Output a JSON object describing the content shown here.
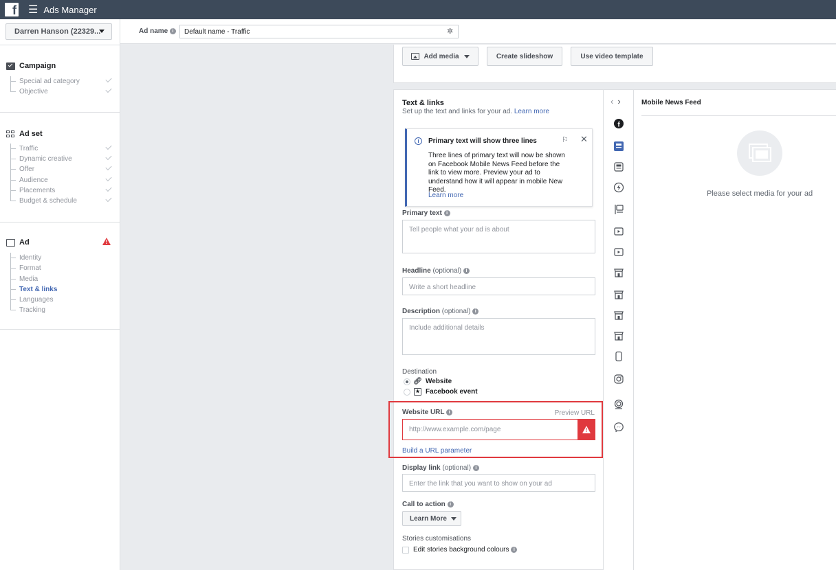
{
  "topbar": {
    "app_title": "Ads Manager"
  },
  "account": {
    "name": "Darren Hanson (22329..."
  },
  "ad_name": {
    "label": "Ad name",
    "value": "Default name - Traffic"
  },
  "nav": {
    "campaign": {
      "title": "Campaign",
      "items": [
        "Special ad category",
        "Objective"
      ]
    },
    "adset": {
      "title": "Ad set",
      "items": [
        "Traffic",
        "Dynamic creative",
        "Offer",
        "Audience",
        "Placements",
        "Budget & schedule"
      ]
    },
    "ad": {
      "title": "Ad",
      "items": [
        "Identity",
        "Format",
        "Media",
        "Text & links",
        "Languages",
        "Tracking"
      ],
      "active": "Text & links"
    }
  },
  "media": {
    "add_media": "Add media",
    "create_slideshow": "Create slideshow",
    "video_template": "Use video template"
  },
  "text_links": {
    "title": "Text & links",
    "subtitle": "Set up the text and links for your ad.",
    "learn_more": "Learn more",
    "notice": {
      "title": "Primary text will show three lines",
      "body": "Three lines of primary text will now be shown on Facebook Mobile News Feed before the link to view more. Preview your ad to understand how it will appear in mobile New Feed.",
      "link": "Learn more"
    },
    "primary_text": {
      "label": "Primary text",
      "placeholder": "Tell people what your ad is about"
    },
    "headline": {
      "label": "Headline",
      "optional": "(optional)",
      "placeholder": "Write a short headline"
    },
    "description": {
      "label": "Description",
      "optional": "(optional)",
      "placeholder": "Include additional details"
    },
    "destination": {
      "label": "Destination",
      "options": [
        "Website",
        "Facebook event"
      ],
      "selected": "Website"
    },
    "website_url": {
      "label": "Website URL",
      "preview": "Preview URL",
      "placeholder": "http://www.example.com/page",
      "build": "Build a URL parameter"
    },
    "display_link": {
      "label": "Display link",
      "optional": "(optional)",
      "placeholder": "Enter the link that you want to show on your ad"
    },
    "cta": {
      "label": "Call to action",
      "value": "Learn More"
    },
    "stories": {
      "label": "Stories customisations",
      "checkbox": "Edit stories background colours"
    }
  },
  "preview": {
    "placement": "Mobile News Feed",
    "empty_message": "Please select media for your ad"
  },
  "colors": {
    "topbar": "#3d4a5a",
    "accent": "#4267b2",
    "error": "#e0393e"
  }
}
